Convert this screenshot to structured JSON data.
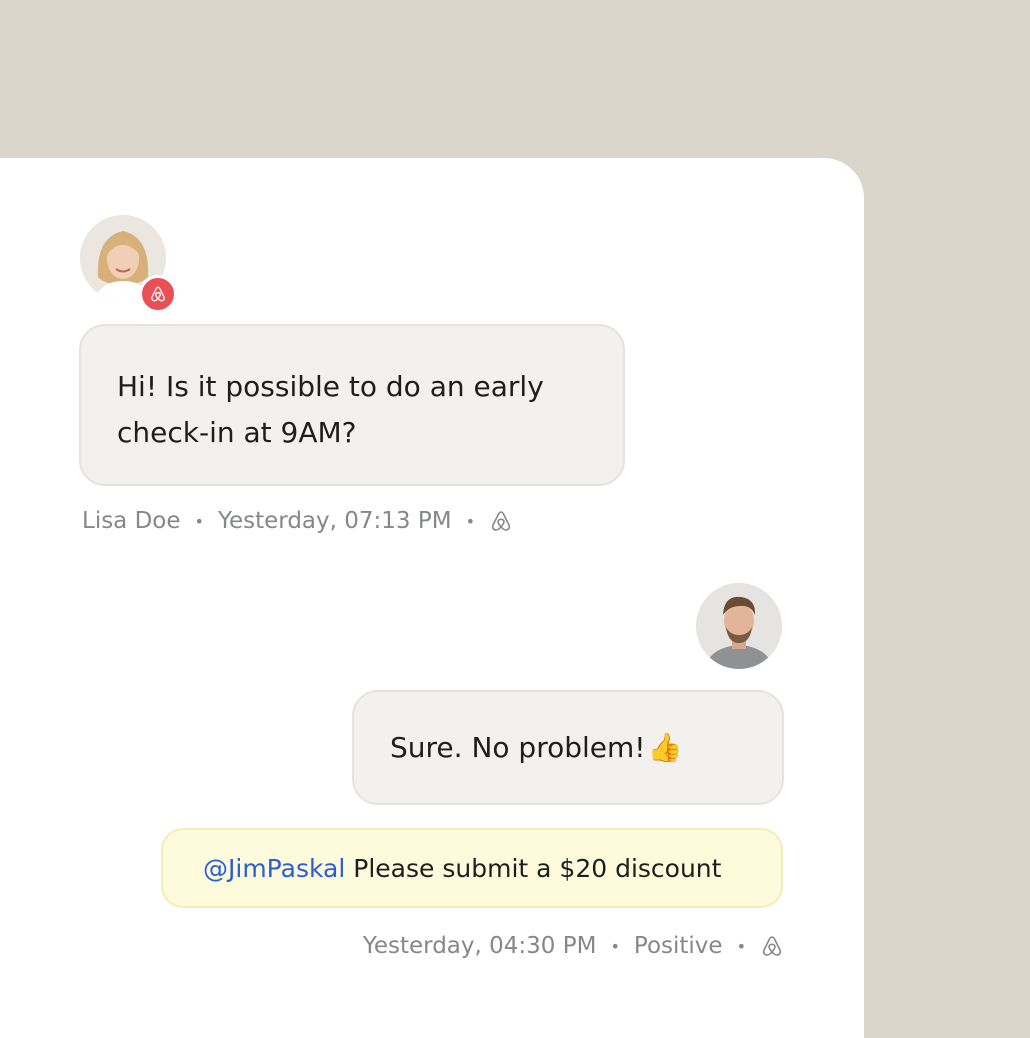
{
  "incoming": {
    "message_line1": "Hi! Is it possible to do an early",
    "message_line2": "check-in at 9AM?",
    "sender": "Lisa Doe",
    "separator": "•",
    "timestamp": "Yesterday, 07:13 PM",
    "channel_icon": "airbnb-icon",
    "badge_icon": "airbnb-icon",
    "badge_color": "#ea4f56"
  },
  "outgoing": {
    "message": "Sure. No problem!",
    "emoji": "👍",
    "note_mention": "@JimPaskal",
    "note_text": "Please submit a $20 discount",
    "timestamp": "Yesterday, 04:30 PM",
    "separator": "•",
    "sentiment": "Positive",
    "channel_icon": "airbnb-icon",
    "note_color": "#fdfbdc",
    "mention_color": "#2a5ed8"
  }
}
